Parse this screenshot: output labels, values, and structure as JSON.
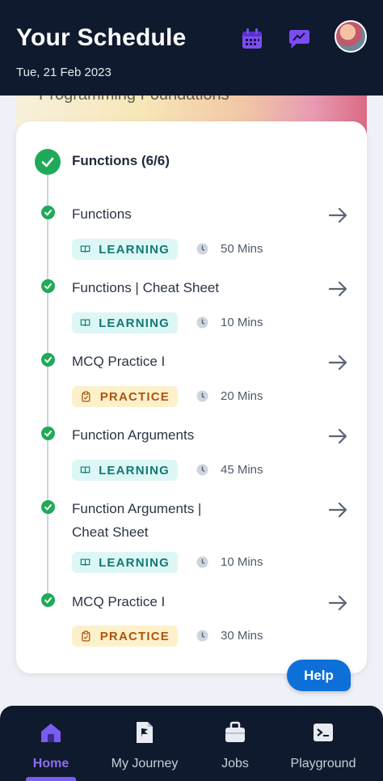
{
  "header": {
    "title": "Your Schedule",
    "date": "Tue, 21 Feb 2023",
    "icons": [
      "calendar-icon",
      "feed-icon",
      "avatar"
    ]
  },
  "banner": {
    "text": "Programming Foundations"
  },
  "module": {
    "title": "Functions (6/6)",
    "items": [
      {
        "title": "Functions",
        "type": "LEARNING",
        "duration": "50 Mins"
      },
      {
        "title": "Functions | Cheat Sheet",
        "type": "LEARNING",
        "duration": "10 Mins"
      },
      {
        "title": "MCQ Practice I",
        "type": "PRACTICE",
        "duration": "20 Mins"
      },
      {
        "title": "Function Arguments",
        "type": "LEARNING",
        "duration": "45 Mins"
      },
      {
        "title": "Function Arguments | Cheat Sheet",
        "type": "LEARNING",
        "duration": "10 Mins"
      },
      {
        "title": "MCQ Practice I",
        "type": "PRACTICE",
        "duration": "30 Mins"
      }
    ]
  },
  "help": {
    "label": "Help"
  },
  "nav": {
    "items": [
      {
        "label": "Home",
        "icon": "home-icon",
        "active": true
      },
      {
        "label": "My Journey",
        "icon": "journey-icon",
        "active": false
      },
      {
        "label": "Jobs",
        "icon": "briefcase-icon",
        "active": false
      },
      {
        "label": "Playground",
        "icon": "terminal-icon",
        "active": false
      }
    ]
  },
  "colors": {
    "header_bg": "#0f1a2e",
    "success": "#1faa59",
    "learning_bg": "#dcf7f6",
    "learning_text": "#127972",
    "practice_bg": "#fdf1cc",
    "practice_text": "#b0530a",
    "accent": "#8b6cf2",
    "help_bg": "#0d6fd8"
  }
}
